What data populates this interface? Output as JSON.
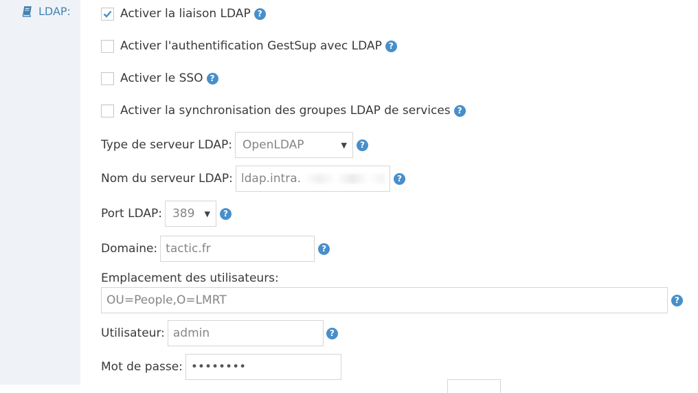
{
  "section": {
    "label": "LDAP:",
    "icon": "book-icon",
    "label_color": "#4383b4"
  },
  "checkboxes": [
    {
      "label": "Activer la liaison LDAP",
      "checked": true
    },
    {
      "label": "Activer l'authentification GestSup avec LDAP",
      "checked": false
    },
    {
      "label": "Activer le SSO",
      "checked": false
    },
    {
      "label": "Activer la synchronisation des groupes LDAP de services",
      "checked": false
    }
  ],
  "server_type": {
    "label": "Type de serveur LDAP:",
    "value": "OpenLDAP"
  },
  "server_name": {
    "label": "Nom du serveur LDAP:",
    "value": "ldap.intra."
  },
  "port": {
    "label": "Port LDAP:",
    "value": "389"
  },
  "domain": {
    "label": "Domaine:",
    "value": "tactic.fr"
  },
  "users_location": {
    "label": "Emplacement des utilisateurs:",
    "value": "OU=People,O=LMRT"
  },
  "user": {
    "label": "Utilisateur:",
    "value": "admin"
  },
  "password": {
    "label": "Mot de passe:",
    "value": "••••••••"
  },
  "help_icon": "question-circle-icon",
  "colors": {
    "accent": "#478fca",
    "sidebar_bg": "#eff3f8"
  }
}
